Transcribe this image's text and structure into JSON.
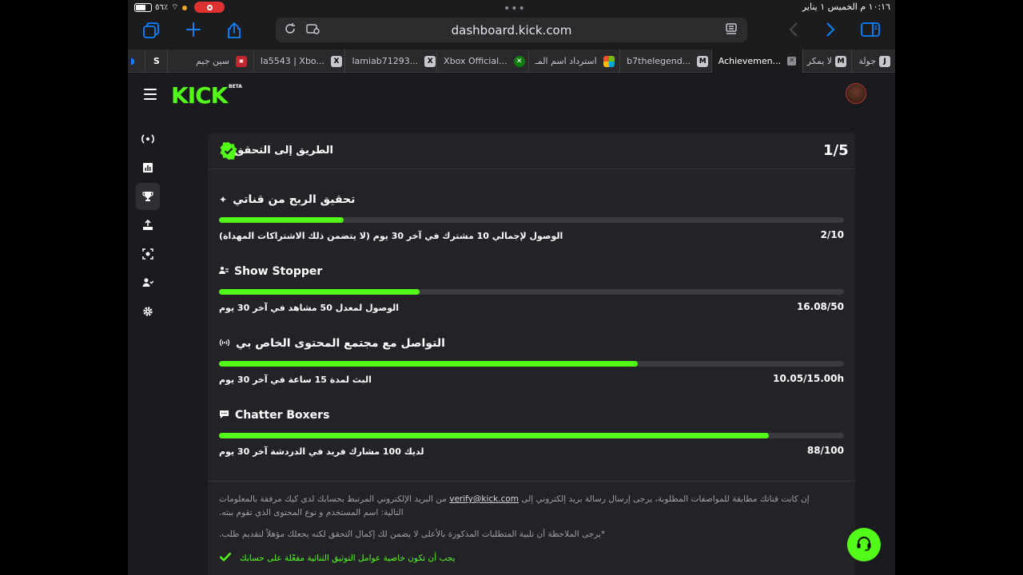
{
  "status_bar": {
    "time": "١٠:١٦ م  الخميس ١ يناير",
    "battery_percent": "٥٦٪"
  },
  "browser": {
    "url": "dashboard.kick.com",
    "tabs": [
      {
        "label": "Achievemen...",
        "favicon": "kick",
        "active": true
      },
      {
        "label": "b7thelegend...",
        "favicon": "M",
        "active": false
      },
      {
        "label": "استرداد اسم المـ",
        "favicon": "microsoft",
        "active": false
      },
      {
        "label": "Xbox Official...",
        "favicon": "xbox",
        "active": false
      },
      {
        "label": "lamiab71293...",
        "favicon": "X",
        "active": false
      },
      {
        "label": "la5543 | Xbo...",
        "favicon": "X",
        "active": false
      },
      {
        "label": "سين جيم",
        "favicon": "game",
        "active": false
      },
      {
        "label": "S",
        "favicon": "S",
        "active": false
      },
      {
        "label": "لا يمكر",
        "favicon": "M",
        "active": false
      },
      {
        "label": "جولة",
        "favicon": "J",
        "active": false
      }
    ]
  },
  "kick": {
    "logo": "KICK",
    "beta": "BETA"
  },
  "card": {
    "title": "الطريق إلى التحقق",
    "progress": "1/5",
    "achievements": [
      {
        "title": "تحقيق الربح من قناتي",
        "icon": "sparkle-icon",
        "description": "الوصول لإجمالي 10 مشترك في آخر 30 يوم (لا يتضمن ذلك الاشتراكات المهداة)",
        "value": "2/10",
        "progress": 0.2
      },
      {
        "title": "Show Stopper",
        "icon": "viewers-icon",
        "description": "الوصول لمعدل 50 مشاهد في آخر 30 يوم",
        "value": "16.08/50",
        "progress": 0.3216
      },
      {
        "title": "التواصل مع مجتمع المحتوى الخاص بي",
        "icon": "broadcast-icon",
        "description": "البث لمدة 15 ساعة في آخر 30 يوم",
        "value": "10.05/15.00h",
        "progress": 0.67
      },
      {
        "title": "Chatter Boxers",
        "icon": "chat-bubble-icon",
        "description": "لديك 100 مشارك فريد في الدردشة آخر 30 يوم",
        "value": "88/100",
        "progress": 0.88
      }
    ],
    "note1_prefix": "إن كانت قناتك مطابقة للمواصفات المطلوبة، يرجى إرسال رسالة بريد إلكتروني إلى",
    "note1_email": "verify@kick.com",
    "note1_suffix": "من البريد الإلكتروني المرتبط بحسابك لدى كيك مرفقة بالمعلومات التالية: اسم المستخدم و نوع المحتوى الذي تقوم ببثه.",
    "note2": "*يرجى الملاحظة أن تلبية المتطلبات المذكورة بالأعلى لا يضمن لك إكمال التحقق لكنه يجعلك مؤهلاً لتقديم طلب.",
    "twofa": "يجب أن تكون خاصية عوامل التوثيق الثنائية مفعّلة على حسابك"
  },
  "colors": {
    "accent": "#53fc18",
    "background": "#1b1b1f",
    "card": "#232327",
    "track": "#3a3a40"
  }
}
